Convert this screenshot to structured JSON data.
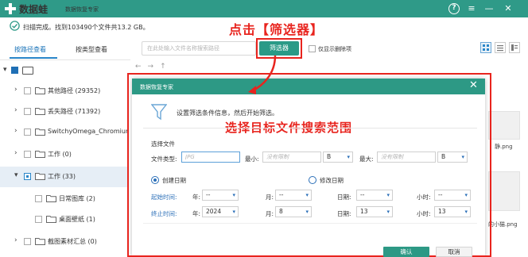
{
  "app": {
    "logo_text": "数据蛙",
    "subtitle": "数据恢复专家",
    "help_glyph": "?",
    "menu_glyph": "≡",
    "minimize_glyph": "—",
    "close_glyph": "✕"
  },
  "scan": {
    "status": "扫描完成。找到103490个文件共13.2 GB。",
    "icon": "check-circle-icon"
  },
  "tabs": [
    {
      "label": "按路径查看",
      "active": true
    },
    {
      "label": "按类型查看",
      "active": false
    }
  ],
  "toolbar": {
    "search_placeholder": "在此处输入文件名称搜索路径",
    "filter_label": "筛选器",
    "show_deleted_label": "仅显示删除项"
  },
  "annotations": {
    "top": "点击【筛选器】",
    "middle": "选择目标文件搜索范围"
  },
  "tree": {
    "items": [
      {
        "label": "其他路径 (29352)"
      },
      {
        "label": "丢失路径 (71392)"
      },
      {
        "label": "SwitchyOmega_Chromiur"
      },
      {
        "label": "工作 (0)"
      },
      {
        "label": "工作 (33)",
        "selected": true
      },
      {
        "label": "日常图库 (2)"
      },
      {
        "label": "桌面壁纸 (1)"
      },
      {
        "label": "截图素材汇总 (0)"
      }
    ]
  },
  "background": {
    "file_label_1": "静.png",
    "file_label_2": "的小猫.png"
  },
  "dialog": {
    "title": "数据恢复专家",
    "instruction": "设置筛选条件信息，然后开始筛选。",
    "section_label": "选择文件",
    "file_type_label": "文件类型:",
    "file_type_placeholder": "JPG",
    "min_label": "最小:",
    "min_placeholder": "没有限制",
    "min_unit": "B",
    "max_label": "最大:",
    "max_placeholder": "没有限制",
    "max_unit": "B",
    "radio_created": "创建日期",
    "radio_modified": "修改日期",
    "start_label": "起始时间:",
    "end_label": "终止时间:",
    "year_label": "年:",
    "month_label": "月:",
    "day_label": "日期:",
    "hour_label": "小时:",
    "start": {
      "year": "--",
      "month": "--",
      "day": "--",
      "hour": "--"
    },
    "end": {
      "year": "2024",
      "month": "8",
      "day": "13",
      "hour": "13"
    },
    "ok_label": "确认",
    "cancel_label": "取消"
  },
  "colors": {
    "brand": "#2f9a88",
    "accent_blue": "#2a86c9",
    "annotation_red": "#e8241e"
  }
}
